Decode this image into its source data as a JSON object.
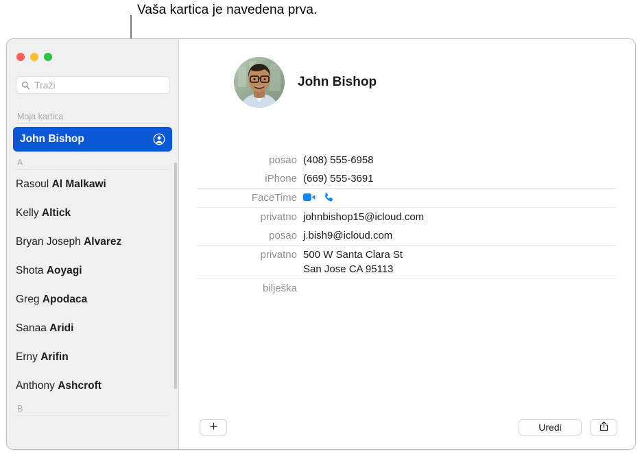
{
  "callout": {
    "text": "Vaša kartica je navedena prva."
  },
  "window": {
    "traffic_lights": [
      "close",
      "minimize",
      "zoom"
    ]
  },
  "sidebar": {
    "search": {
      "placeholder": "Traži",
      "value": "",
      "icon": "search-icon"
    },
    "sections": [
      {
        "header": "Moja kartica",
        "rows": [
          {
            "first": "John",
            "last": "Bishop",
            "selected": true,
            "icon": "person-circle-icon"
          }
        ]
      },
      {
        "header": "A",
        "rows": [
          {
            "first": "Rasoul",
            "last": "Al Malkawi",
            "selected": false
          },
          {
            "first": "Kelly",
            "last": "Altick",
            "selected": false
          },
          {
            "first": "Bryan Joseph",
            "last": "Alvarez",
            "selected": false
          },
          {
            "first": "Shota",
            "last": "Aoyagi",
            "selected": false
          },
          {
            "first": "Greg",
            "last": "Apodaca",
            "selected": false
          },
          {
            "first": "Sanaa",
            "last": "Aridi",
            "selected": false
          },
          {
            "first": "Erny",
            "last": "Arifin",
            "selected": false
          },
          {
            "first": "Anthony",
            "last": "Ashcroft",
            "selected": false
          }
        ]
      },
      {
        "header": "B",
        "rows": []
      }
    ]
  },
  "detail": {
    "name": "John Bishop",
    "avatar_alt": "portrait-photo",
    "field_groups": [
      {
        "fields": [
          {
            "label": "posao",
            "value": "(408) 555-6958",
            "kind": "text"
          },
          {
            "label": "iPhone",
            "value": "(669) 555-3691",
            "kind": "text"
          }
        ]
      },
      {
        "fields": [
          {
            "label": "FaceTime",
            "value": "",
            "kind": "icons",
            "icons": [
              "facetime-video-icon",
              "facetime-audio-icon"
            ]
          }
        ]
      },
      {
        "fields": [
          {
            "label": "privatno",
            "value": "johnbishop15@icloud.com",
            "kind": "text"
          },
          {
            "label": "posao",
            "value": "j.bish9@icloud.com",
            "kind": "text"
          }
        ]
      },
      {
        "fields": [
          {
            "label": "privatno",
            "value": "500 W Santa Clara St\nSan Jose CA 95113",
            "kind": "text"
          }
        ]
      },
      {
        "fields": [
          {
            "label": "bilješka",
            "value": "",
            "kind": "text"
          }
        ]
      }
    ]
  },
  "toolbar": {
    "add_label": "+",
    "edit_label": "Uredi",
    "share_icon": "share-icon"
  },
  "colors": {
    "accent_blue": "#0a58d6",
    "facetime_blue": "#0b84ff",
    "sidebar_bg": "#f0f0f0",
    "label_gray": "#8e8e8e"
  }
}
